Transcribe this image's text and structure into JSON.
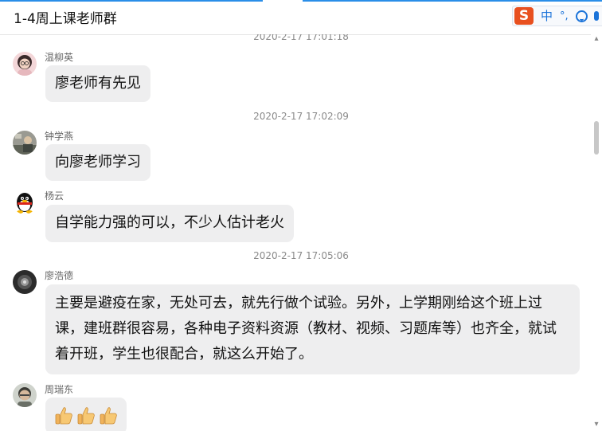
{
  "window": {
    "title": "1-4周上课老师群"
  },
  "ime": {
    "logo": "S",
    "mode": "中",
    "punct": "°,",
    "colors": {
      "logo": "#e8501f",
      "accent": "#1a73d9"
    }
  },
  "messages": [
    {
      "type": "timestamp",
      "text": "2020-2-17 17:01:18"
    },
    {
      "type": "message",
      "sender": "温柳英",
      "text": "廖老师有先见",
      "avatar": "female-avatar"
    },
    {
      "type": "timestamp",
      "text": "2020-2-17 17:02:09"
    },
    {
      "type": "message",
      "sender": "钟学燕",
      "text": "向廖老师学习",
      "avatar": "photo-avatar"
    },
    {
      "type": "message",
      "sender": "杨云",
      "text": "自学能力强的可以，不少人估计老火",
      "avatar": "penguin-avatar"
    },
    {
      "type": "timestamp",
      "text": "2020-2-17 17:05:06"
    },
    {
      "type": "message",
      "sender": "廖浩德",
      "text": "主要是避疫在家，无处可去，就先行做个试验。另外，上学期刚给这个班上过课，建班群很容易，各种电子资料资源（教材、视频、习题库等）也齐全，就试着开班，学生也很配合，就这么开始了。",
      "avatar": "dark-avatar"
    },
    {
      "type": "message",
      "sender": "周瑞东",
      "text": "",
      "emoji": [
        "thumbs-up",
        "thumbs-up",
        "thumbs-up"
      ],
      "avatar": "man-avatar"
    }
  ],
  "colors": {
    "bubble": "#eeeeef",
    "accent": "#2a8ee8",
    "timestamp": "#8a8a8a"
  }
}
